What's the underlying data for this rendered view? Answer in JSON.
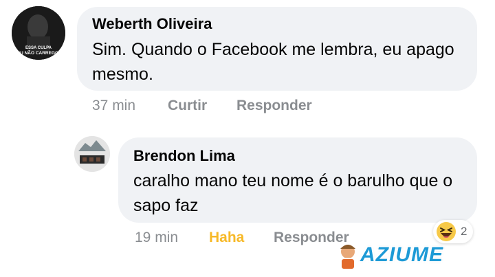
{
  "comment1": {
    "avatar_caption": [
      "ESSA CULPA",
      "EU NÃO CARREGO!"
    ],
    "author": "Weberth Oliveira",
    "text": "Sim. Quando o Facebook me lembra, eu apago mesmo.",
    "time": "37 min",
    "like_label": "Curtir",
    "reply_label": "Responder"
  },
  "comment2": {
    "author": "Brendon Lima",
    "text": "caralho mano teu nome é o barulho que o sapo faz",
    "time": "19 min",
    "reaction_label": "Haha",
    "reply_label": "Responder",
    "reaction_count": "2",
    "reaction_icon": "haha-emoji-icon"
  },
  "watermark": {
    "text": "AZIUME"
  },
  "colors": {
    "bubble": "#f0f2f5",
    "meta": "#8a8d91",
    "haha": "#f7b928",
    "watermark": "#1d9ad6"
  }
}
